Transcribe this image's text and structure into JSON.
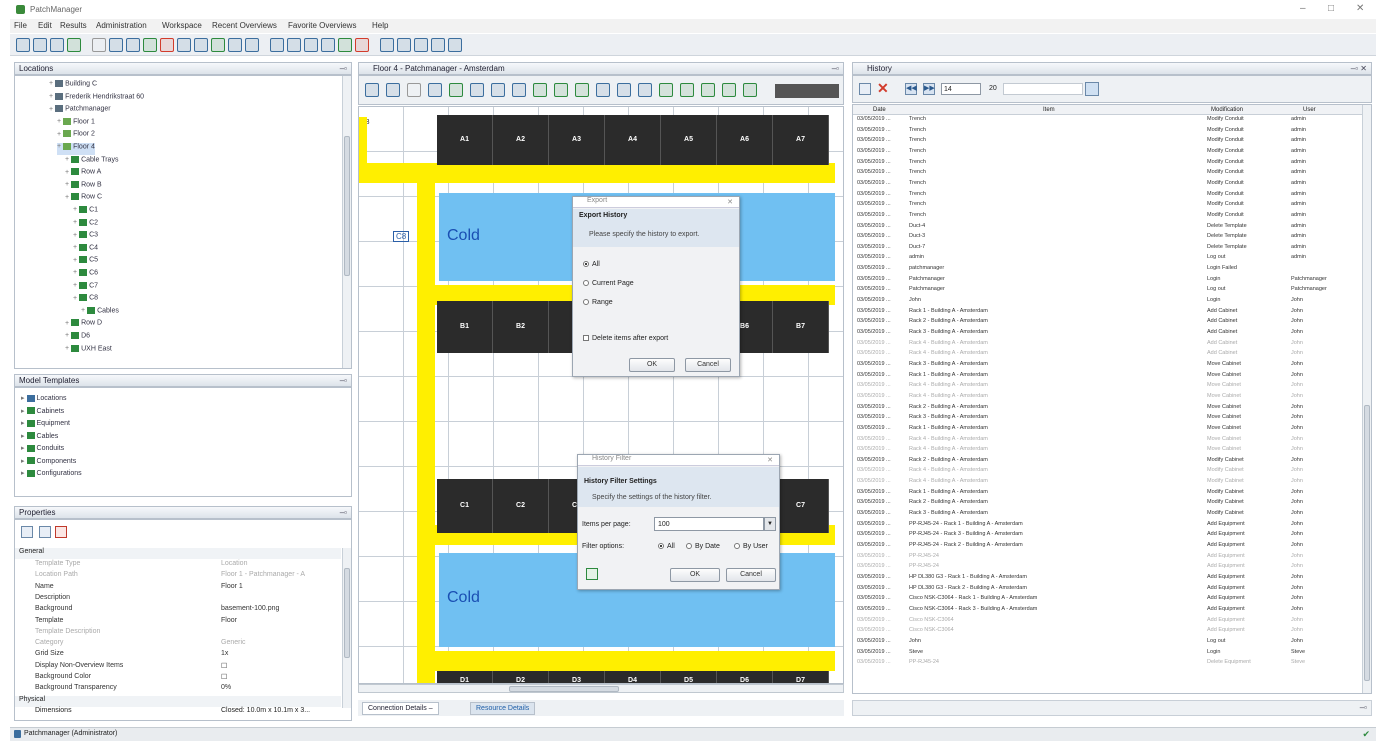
{
  "window": {
    "title": "PatchManager",
    "controls": [
      "–",
      "□",
      "✕"
    ]
  },
  "menu": [
    "File",
    "Edit",
    "Results",
    "Administration",
    "Workspace",
    "Recent Overviews",
    "Favorite Overviews",
    "Help"
  ],
  "toolbar_icon_colors": [
    "#3c6e9e",
    "#3c6e9e",
    "#3c6e9e",
    "#2d8a3e",
    "#999",
    "#3c6e9e",
    "#3c6e9e",
    "#2d8a3e",
    "#d23c2c",
    "#3c6e9e",
    "#3c6e9e",
    "#2d8a3e",
    "#3c6e9e",
    "#3c6e9e",
    "#3c6e9e",
    "#3c6e9e",
    "#3c6e9e",
    "#3c6e9e",
    "#2d8a3e",
    "#d23c2c",
    "#3c6e9e",
    "#3c6e9e",
    "#3c6e9e",
    "#3c6e9e",
    "#3c6e9e"
  ],
  "locations": {
    "title": "Locations",
    "items": [
      {
        "label": "Building C",
        "indent": 4,
        "color": "#5a6e7e"
      },
      {
        "label": "Frederik Hendrikstraat 60",
        "indent": 4,
        "color": "#5a6e7e"
      },
      {
        "label": "Patchmanager",
        "indent": 4,
        "color": "#5a6e7e"
      },
      {
        "label": "Floor 1",
        "indent": 5,
        "color": "#6aa84f"
      },
      {
        "label": "Floor 2",
        "indent": 5,
        "color": "#6aa84f"
      },
      {
        "label": "Floor 4",
        "indent": 5,
        "color": "#6aa84f",
        "selected": true
      },
      {
        "label": "Cable Trays",
        "indent": 6,
        "color": "#2d8a3e"
      },
      {
        "label": "Row A",
        "indent": 6,
        "color": "#2d8a3e"
      },
      {
        "label": "Row B",
        "indent": 6,
        "color": "#2d8a3e"
      },
      {
        "label": "Row C",
        "indent": 6,
        "color": "#2d8a3e"
      },
      {
        "label": "C1",
        "indent": 7,
        "color": "#2d8a3e"
      },
      {
        "label": "C2",
        "indent": 7,
        "color": "#2d8a3e"
      },
      {
        "label": "C3",
        "indent": 7,
        "color": "#2d8a3e"
      },
      {
        "label": "C4",
        "indent": 7,
        "color": "#2d8a3e"
      },
      {
        "label": "C5",
        "indent": 7,
        "color": "#2d8a3e"
      },
      {
        "label": "C6",
        "indent": 7,
        "color": "#2d8a3e"
      },
      {
        "label": "C7",
        "indent": 7,
        "color": "#2d8a3e"
      },
      {
        "label": "C8",
        "indent": 7,
        "color": "#2d8a3e"
      },
      {
        "label": "Cables",
        "indent": 8,
        "color": "#2d8a3e"
      },
      {
        "label": "Row D",
        "indent": 6,
        "color": "#2d8a3e"
      },
      {
        "label": "D6",
        "indent": 6,
        "color": "#2d8a3e"
      },
      {
        "label": "UXH East",
        "indent": 6,
        "color": "#2d8a3e"
      }
    ]
  },
  "model_templates": {
    "title": "Model Templates",
    "items": [
      "Locations",
      "Cabinets",
      "Equipment",
      "Cables",
      "Conduits",
      "Components",
      "Configurations"
    ]
  },
  "properties": {
    "title": "Properties",
    "section_general": "General",
    "section_physical": "Physical",
    "rows": [
      {
        "k": "Template Type",
        "v": "Location",
        "gray": true
      },
      {
        "k": "Location Path",
        "v": "Floor 1 - Patchmanager - A",
        "gray": true
      },
      {
        "k": "Name",
        "v": "Floor 1",
        "gray": false
      },
      {
        "k": "Description",
        "v": "",
        "gray": false
      },
      {
        "k": "Background",
        "v": "basement-100.png",
        "gray": false
      },
      {
        "k": "Template",
        "v": "Floor",
        "gray": false
      },
      {
        "k": "Template Description",
        "v": "",
        "gray": true
      },
      {
        "k": "Category",
        "v": "Generic",
        "gray": true
      },
      {
        "k": "Grid Size",
        "v": "1x",
        "gray": false
      },
      {
        "k": "Display Non-Overview Items",
        "v": "☐",
        "gray": false
      },
      {
        "k": "Background Color",
        "v": "☐",
        "gray": false
      },
      {
        "k": "Background Transparency",
        "v": "0%",
        "gray": false
      }
    ],
    "physical_row": {
      "k": "Dimensions",
      "v": "Closed: 10.0m x 10.1m x 3..."
    }
  },
  "floor_tab": {
    "title": "Floor 4 - Patchmanager - Amsterdam"
  },
  "floor": {
    "row_a": [
      "A1",
      "A2",
      "A3",
      "A4",
      "A5",
      "A6",
      "A7"
    ],
    "row_b": [
      "B1",
      "B2",
      "B3",
      "",
      "",
      "B6",
      "B7"
    ],
    "row_c": [
      "C1",
      "C2",
      "C3",
      "",
      "",
      "",
      "C7"
    ],
    "row_d": [
      "D1",
      "D2",
      "D3",
      "D4",
      "D5",
      "D6",
      "D7"
    ],
    "cold": "Cold",
    "tag_left": "C8"
  },
  "export_dialog": {
    "title": "Export",
    "header": "Export History",
    "subheader": "Please specify the history to export.",
    "options": [
      "All",
      "Current Page",
      "Range"
    ],
    "checkbox": "Delete items after export",
    "ok": "OK",
    "cancel": "Cancel"
  },
  "filter_dialog": {
    "title": "History Filter",
    "header": "History Filter Settings",
    "subheader": "Specify the settings of the history filter.",
    "items_per_page_label": "Items per page:",
    "items_per_page_value": "100",
    "filter_label": "Filter options:",
    "filter_options": [
      "All",
      "By Date",
      "By User"
    ],
    "ok": "OK",
    "cancel": "Cancel"
  },
  "history": {
    "title": "History",
    "page": "14",
    "total": "20",
    "columns": [
      "Date",
      "Item",
      "Modification",
      "User"
    ],
    "rows": [
      [
        "03/05/2019 ...",
        "Trench",
        "Modify Conduit",
        "admin",
        0
      ],
      [
        "03/05/2019 ...",
        "Trench",
        "Modify Conduit",
        "admin",
        0
      ],
      [
        "03/05/2019 ...",
        "Trench",
        "Modify Conduit",
        "admin",
        0
      ],
      [
        "03/05/2019 ...",
        "Trench",
        "Modify Conduit",
        "admin",
        0
      ],
      [
        "03/05/2019 ...",
        "Trench",
        "Modify Conduit",
        "admin",
        0
      ],
      [
        "03/05/2019 ...",
        "Trench",
        "Modify Conduit",
        "admin",
        0
      ],
      [
        "03/05/2019 ...",
        "Trench",
        "Modify Conduit",
        "admin",
        0
      ],
      [
        "03/05/2019 ...",
        "Trench",
        "Modify Conduit",
        "admin",
        0
      ],
      [
        "03/05/2019 ...",
        "Trench",
        "Modify Conduit",
        "admin",
        0
      ],
      [
        "03/05/2019 ...",
        "Trench",
        "Modify Conduit",
        "admin",
        0
      ],
      [
        "03/05/2019 ...",
        "Duct-4",
        "Delete Template",
        "admin",
        0
      ],
      [
        "03/05/2019 ...",
        "Duct-3",
        "Delete Template",
        "admin",
        0
      ],
      [
        "03/05/2019 ...",
        "Duct-7",
        "Delete Template",
        "admin",
        0
      ],
      [
        "03/05/2019 ...",
        "admin",
        "Log out",
        "admin",
        0
      ],
      [
        "03/05/2019 ...",
        "patchmanager",
        "Login Failed",
        "",
        0
      ],
      [
        "03/05/2019 ...",
        "Patchmanager",
        "Login",
        "Patchmanager",
        0
      ],
      [
        "03/05/2019 ...",
        "Patchmanager",
        "Log out",
        "Patchmanager",
        0
      ],
      [
        "03/05/2019 ...",
        "John",
        "Login",
        "John",
        0
      ],
      [
        "03/05/2019 ...",
        "Rack 1 - Building A - Amsterdam",
        "Add Cabinet",
        "John",
        0
      ],
      [
        "03/05/2019 ...",
        "Rack 2 - Building A - Amsterdam",
        "Add Cabinet",
        "John",
        0
      ],
      [
        "03/05/2019 ...",
        "Rack 3 - Building A - Amsterdam",
        "Add Cabinet",
        "John",
        0
      ],
      [
        "03/05/2019 ...",
        "Rack 4 - Building A - Amsterdam",
        "Add Cabinet",
        "John",
        1
      ],
      [
        "03/05/2019 ...",
        "Rack 4 - Building A - Amsterdam",
        "Add Cabinet",
        "John",
        1
      ],
      [
        "03/05/2019 ...",
        "Rack 3 - Building A - Amsterdam",
        "Move Cabinet",
        "John",
        0
      ],
      [
        "03/05/2019 ...",
        "Rack 1 - Building A - Amsterdam",
        "Move Cabinet",
        "John",
        0
      ],
      [
        "03/05/2019 ...",
        "Rack 4 - Building A - Amsterdam",
        "Move Cabinet",
        "John",
        1
      ],
      [
        "03/05/2019 ...",
        "Rack 4 - Building A - Amsterdam",
        "Move Cabinet",
        "John",
        1
      ],
      [
        "03/05/2019 ...",
        "Rack 2 - Building A - Amsterdam",
        "Move Cabinet",
        "John",
        0
      ],
      [
        "03/05/2019 ...",
        "Rack 3 - Building A - Amsterdam",
        "Move Cabinet",
        "John",
        0
      ],
      [
        "03/05/2019 ...",
        "Rack 1 - Building A - Amsterdam",
        "Move Cabinet",
        "John",
        0
      ],
      [
        "03/05/2019 ...",
        "Rack 4 - Building A - Amsterdam",
        "Move Cabinet",
        "John",
        1
      ],
      [
        "03/05/2019 ...",
        "Rack 4 - Building A - Amsterdam",
        "Move Cabinet",
        "John",
        1
      ],
      [
        "03/05/2019 ...",
        "Rack 2 - Building A - Amsterdam",
        "Modify Cabinet",
        "John",
        0
      ],
      [
        "03/05/2019 ...",
        "Rack 4 - Building A - Amsterdam",
        "Modify Cabinet",
        "John",
        1
      ],
      [
        "03/05/2019 ...",
        "Rack 4 - Building A - Amsterdam",
        "Modify Cabinet",
        "John",
        1
      ],
      [
        "03/05/2019 ...",
        "Rack 1 - Building A - Amsterdam",
        "Modify Cabinet",
        "John",
        0
      ],
      [
        "03/05/2019 ...",
        "Rack 2 - Building A - Amsterdam",
        "Modify Cabinet",
        "John",
        0
      ],
      [
        "03/05/2019 ...",
        "Rack 3 - Building A - Amsterdam",
        "Modify Cabinet",
        "John",
        0
      ],
      [
        "03/05/2019 ...",
        "PP-RJ45-24 - Rack 1 - Building A - Amsterdam",
        "Add Equipment",
        "John",
        0
      ],
      [
        "03/05/2019 ...",
        "PP-RJ45-24 - Rack 3 - Building A - Amsterdam",
        "Add Equipment",
        "John",
        0
      ],
      [
        "03/05/2019 ...",
        "PP-RJ45-24 - Rack 2 - Building A - Amsterdam",
        "Add Equipment",
        "John",
        0
      ],
      [
        "03/05/2019 ...",
        "PP-RJ45-24",
        "Add Equipment",
        "John",
        1
      ],
      [
        "03/05/2019 ...",
        "PP-RJ45-24",
        "Add Equipment",
        "John",
        1
      ],
      [
        "03/05/2019 ...",
        "HP DL380 G3 - Rack 1 - Building A - Amsterdam",
        "Add Equipment",
        "John",
        0
      ],
      [
        "03/05/2019 ...",
        "HP DL380 G3 - Rack 2 - Building A - Amsterdam",
        "Add Equipment",
        "John",
        0
      ],
      [
        "03/05/2019 ...",
        "Cisco NSK-C3064 - Rack 1 - Building A - Amsterdam",
        "Add Equipment",
        "John",
        0
      ],
      [
        "03/05/2019 ...",
        "Cisco NSK-C3064 - Rack 3 - Building A - Amsterdam",
        "Add Equipment",
        "John",
        0
      ],
      [
        "03/05/2019 ...",
        "Cisco NSK-C3064",
        "Add Equipment",
        "John",
        1
      ],
      [
        "03/05/2019 ...",
        "Cisco NSK-C3064",
        "Add Equipment",
        "John",
        1
      ],
      [
        "03/05/2019 ...",
        "John",
        "Log out",
        "John",
        0
      ],
      [
        "03/05/2019 ...",
        "Steve",
        "Login",
        "Steve",
        0
      ],
      [
        "03/05/2019 ...",
        "PP-RJ45-24",
        "Delete Equipment",
        "Steve",
        1
      ]
    ]
  },
  "bottom_tabs": [
    "Connection Details",
    "Resource Details"
  ],
  "status": {
    "text": "Patchmanager (Administrator)"
  }
}
